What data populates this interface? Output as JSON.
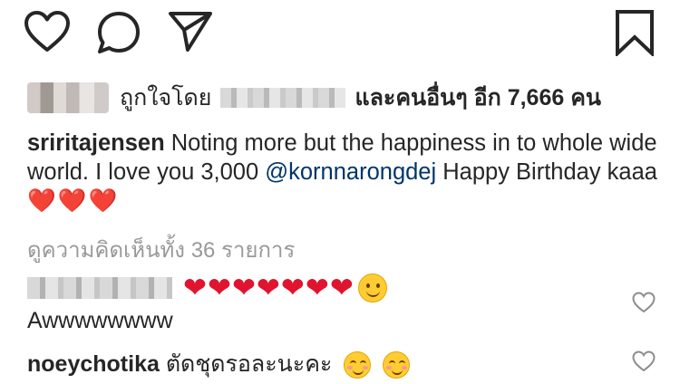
{
  "actions": {
    "like_icon": "heart-outline-icon",
    "comment_icon": "speech-bubble-icon",
    "share_icon": "paper-plane-icon",
    "save_icon": "bookmark-icon"
  },
  "likes": {
    "liked_by": "ถูกใจโดย",
    "and_others": "และคนอื่นๆ อีก 7,666 คน"
  },
  "caption": {
    "username": "sriritajensen",
    "text": " Noting more but the happiness in to whole wide world. I love you 3,000 ",
    "mention": "@kornnarongdej",
    "text2": " Happy Birthday kaaa ",
    "emoji": "❤️❤️❤️"
  },
  "view_all_comments": "ดูความคิดเห็นทั้ง 36 รายการ",
  "comments": [
    {
      "text": "❤❤❤❤❤❤❤",
      "line2": "Awwwwwwww"
    },
    {
      "username": "noeychotika",
      "text": " ตัดชุดรอละนะคะ "
    }
  ],
  "colors": {
    "accent_link": "#003569",
    "heart_red": "#e0142e",
    "muted": "#999999"
  }
}
